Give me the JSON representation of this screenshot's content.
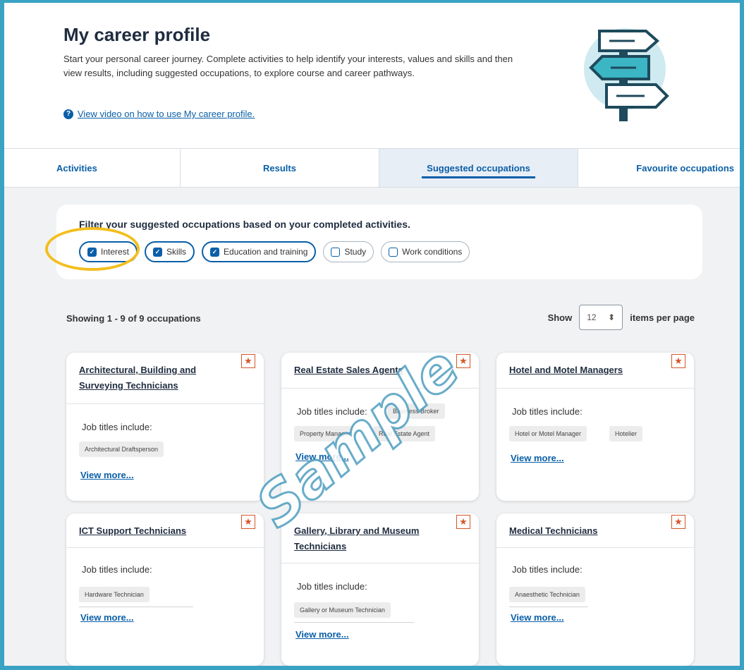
{
  "header": {
    "title": "My career profile",
    "description": "Start your personal career journey. Complete activities to help identify your interests, values and skills and then view results, including suggested occupations, to explore course and career pathways.",
    "video_link": "View video on how to use My career profile."
  },
  "tabs": [
    "Activities",
    "Results",
    "Suggested occupations",
    "Favourite occupations"
  ],
  "active_tab": "Suggested occupations",
  "filter": {
    "title": "Filter your suggested occupations based on your completed activities.",
    "chips": [
      {
        "label": "Interest",
        "checked": true
      },
      {
        "label": "Skills",
        "checked": true
      },
      {
        "label": "Education and training",
        "checked": true
      },
      {
        "label": "Study",
        "checked": false
      },
      {
        "label": "Work conditions",
        "checked": false
      }
    ]
  },
  "results": {
    "showing": "Showing 1 - 9 of 9 occupations",
    "show_label": "Show",
    "per_page_value": "12",
    "per_page_suffix": "items per page"
  },
  "cards": [
    {
      "title": "Architectural, Building and Surveying Technicians",
      "job_label": "Job titles include:",
      "jobs": [
        "Architectural Draftsperson"
      ],
      "view_more": "View more..."
    },
    {
      "title": "Real Estate Sales Agents",
      "job_label": "Job titles include:",
      "jobs": [
        "Business Broker",
        "Property Manager",
        "Real Estate Agent"
      ],
      "view_more": "View more..."
    },
    {
      "title": "Hotel and Motel Managers",
      "job_label": "Job titles include:",
      "jobs": [
        "Hotel or Motel Manager",
        "Hotelier"
      ],
      "view_more": "View more..."
    },
    {
      "title": "ICT Support Technicians",
      "job_label": "Job titles include:",
      "jobs": [
        "Hardware Technician"
      ],
      "view_more": "View more..."
    },
    {
      "title": "Gallery, Library and Museum Technicians",
      "job_label": "Job titles include:",
      "jobs": [
        "Gallery or Museum Technician"
      ],
      "view_more": "View more..."
    },
    {
      "title": "Medical Technicians",
      "job_label": "Job titles include:",
      "jobs": [
        "Anaesthetic Technician"
      ],
      "view_more": "View more..."
    }
  ],
  "watermark": "Sample",
  "colors": {
    "accent": "#0a5fa8",
    "frame": "#3aa3c3",
    "highlight": "#f3be1d",
    "star": "#d5572a"
  }
}
